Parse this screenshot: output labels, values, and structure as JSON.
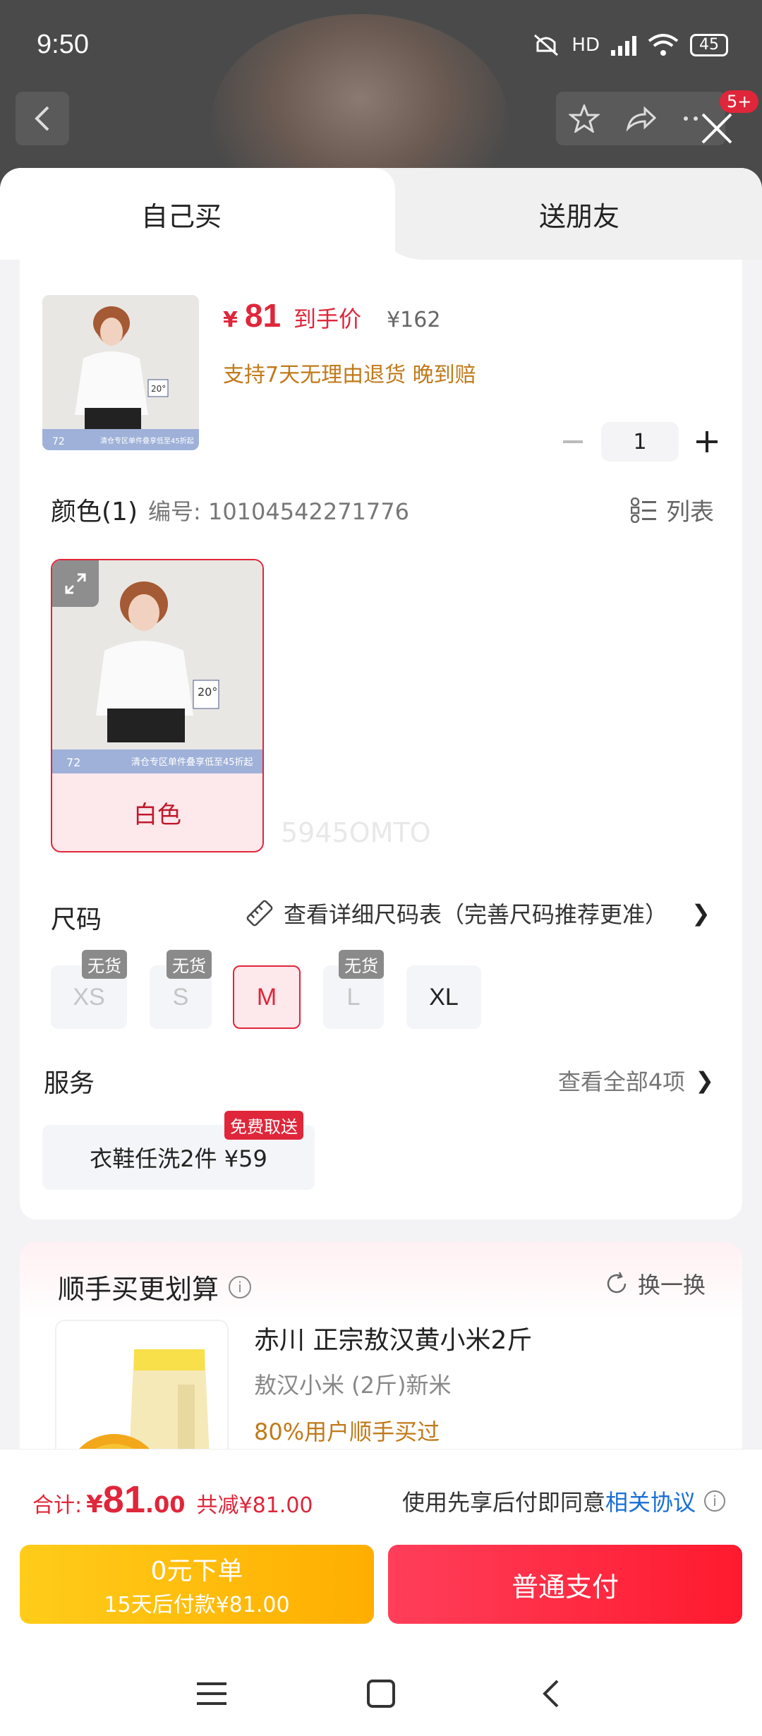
{
  "status_bar": {
    "time": "9:50",
    "network": "HD",
    "battery": "45"
  },
  "background": {
    "notification_badge": "5+"
  },
  "tabs": [
    {
      "label": "自己买",
      "active": true
    },
    {
      "label": "送朋友",
      "active": false
    }
  ],
  "product": {
    "currency": "¥",
    "price": "81",
    "price_label": "到手价",
    "original_price": "¥162",
    "service_note": "支持7天无理由退货  晚到赔",
    "quantity": "1",
    "thumb_tag_top": "20°",
    "thumb_bottom_left": "72",
    "thumb_banner": "清仓专区单件叠享低至45折起"
  },
  "color": {
    "title": "颜色(1)",
    "code": "编号: 10104542271776",
    "list_label": "列表",
    "options": [
      {
        "label": "白色",
        "selected": true
      }
    ],
    "watermark": "5945OMTO"
  },
  "size": {
    "title": "尺码",
    "chart_link": "查看详细尺码表（完善尺码推荐更准）",
    "out_of_stock": "无货",
    "options": [
      {
        "label": "XS",
        "state": "disabled"
      },
      {
        "label": "S",
        "state": "disabled"
      },
      {
        "label": "M",
        "state": "selected"
      },
      {
        "label": "L",
        "state": "disabled"
      },
      {
        "label": "XL",
        "state": "normal"
      }
    ]
  },
  "services": {
    "title": "服务",
    "view_all": "查看全部4项",
    "chip_label": "衣鞋任洗2件  ¥59",
    "chip_tag": "免费取送"
  },
  "recommendation": {
    "title": "顺手买更划算",
    "refresh": "换一换",
    "item_name": "赤川 正宗敖汉黄小米2斤",
    "item_sub": "敖汉小米 (2斤)新米",
    "item_stat": "80%用户顺手买过"
  },
  "summary": {
    "total_label": "合计:",
    "currency": "¥",
    "total_int": "81",
    "total_dec": ".00",
    "saved": "共减¥81.00",
    "agree_text": "使用先享后付即同意",
    "agree_link": "相关协议"
  },
  "buttons": {
    "pay_later_line1": "0元下单",
    "pay_later_line2": "15天后付款¥81.00",
    "pay_now": "普通支付"
  },
  "colors": {
    "accent": "#e0263a",
    "gold": "#c07a1a",
    "link": "#1a6fd6"
  },
  "icons": [
    "back-icon",
    "star-icon",
    "share-icon",
    "more-icon",
    "close-icon",
    "list-icon",
    "expand-icon",
    "ruler-icon",
    "chevron-right-icon",
    "info-icon",
    "refresh-icon",
    "menu-icon",
    "home-icon"
  ]
}
